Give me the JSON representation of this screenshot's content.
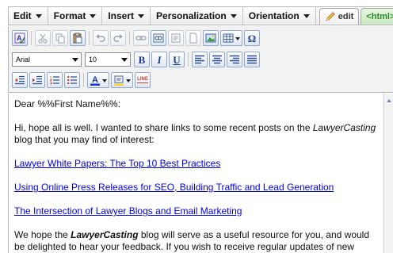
{
  "menu": {
    "items": [
      {
        "label": "Edit"
      },
      {
        "label": "Format"
      },
      {
        "label": "Insert"
      },
      {
        "label": "Personalization"
      },
      {
        "label": "Orientation"
      }
    ],
    "tabs": {
      "edit_label": "edit",
      "html_label": "<html>"
    }
  },
  "toolbar": {
    "font_family": "Arial",
    "font_size": "10",
    "bold_label": "B",
    "italic_label": "I",
    "underline_label": "U",
    "line_label": "LINE",
    "omega_label": "Ω",
    "icons": [
      "spellcheck-icon",
      "cut-icon",
      "copy-icon",
      "paste-icon",
      "undo-icon",
      "redo-icon",
      "insert-link-icon",
      "unlink-icon",
      "anchor-icon",
      "page-icon",
      "image-icon",
      "table-icon",
      "special-char-icon",
      "align-left-icon",
      "align-center-icon",
      "align-right-icon",
      "justify-icon",
      "outdent-icon",
      "indent-icon",
      "numbered-list-icon",
      "bulleted-list-icon",
      "text-color-icon",
      "highlight-icon",
      "horizontal-line-icon"
    ],
    "accent_color": "#1d3b8c",
    "text_color_bar": "#1a36c8"
  },
  "editor": {
    "greeting": "Dear %%First Name%%:",
    "intro_before": "Hi, hope all is well. I wanted to share links to some recent posts on the ",
    "intro_brand": "LawyerCasting",
    "intro_after": " blog that you may find of interest:",
    "links": [
      "Lawyer White Papers: The Top 10 Best Practices",
      "Using Online Press Releases for SEO, Building Traffic and Lead Generation",
      "The Intersection of Lawyer Blogs and Email Marketing"
    ],
    "outro_before": "We hope the ",
    "outro_brand": "LawyerCasting",
    "outro_after": " blog will serve as a useful resource for you, and would be delighted to hear your feedback. If you wish to receive regular updates of new posts via",
    "link_color": "#0000ee"
  }
}
